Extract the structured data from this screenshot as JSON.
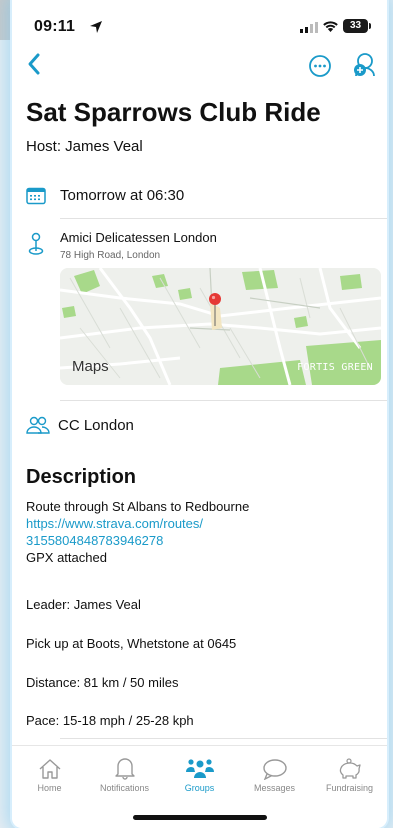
{
  "status": {
    "time": "09:11",
    "battery": "33"
  },
  "event": {
    "title": "Sat Sparrows Club Ride",
    "host": "Host: James Veal",
    "date": "Tomorrow at 06:30",
    "venue_name": "Amici Delicatessen London",
    "venue_address": "78 High Road, London",
    "map_attribution": "Maps",
    "map_place": "FORTIS GREEN",
    "club": "CC London"
  },
  "description": {
    "heading": "Description",
    "line1": "Route through St Albans to Redbourne",
    "link": "https://www.strava.com/routes/",
    "link2": "3155804848783946278",
    "line2": "GPX attached",
    "leader": "Leader: James Veal",
    "pickup": "Pick up at Boots, Whetstone at 0645",
    "distance": "Distance: 81 km / 50 miles",
    "pace": "Pace: 15-18 mph / 25-28 kph"
  },
  "tabs": [
    {
      "label": "Home",
      "icon": "home-icon"
    },
    {
      "label": "Notifications",
      "icon": "bell-icon"
    },
    {
      "label": "Groups",
      "icon": "groups-icon",
      "active": true
    },
    {
      "label": "Messages",
      "icon": "chat-bubble-icon"
    },
    {
      "label": "Fundraising",
      "icon": "piggy-bank-icon"
    }
  ],
  "colors": {
    "accent": "#1a9ac9",
    "map_park": "#9ad07a",
    "pin": "#e53935"
  }
}
